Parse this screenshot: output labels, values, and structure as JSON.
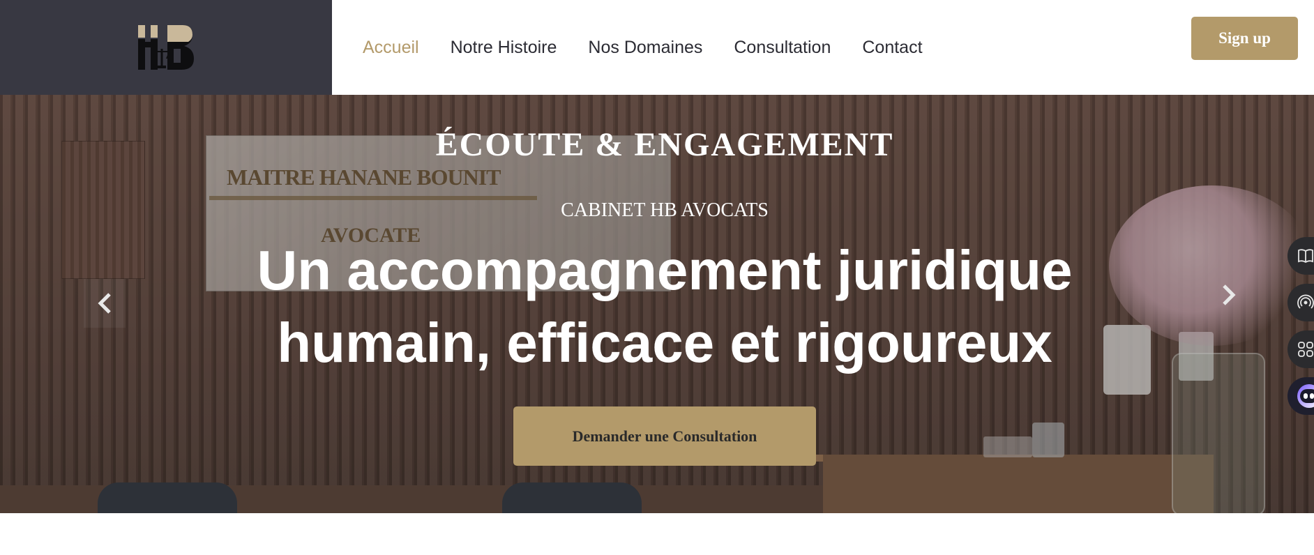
{
  "header": {
    "nav": [
      {
        "label": "Accueil",
        "active": true
      },
      {
        "label": "Notre Histoire",
        "active": false
      },
      {
        "label": "Nos Domaines",
        "active": false
      },
      {
        "label": "Consultation",
        "active": false
      },
      {
        "label": "Contact",
        "active": false
      }
    ],
    "signup_label": "Sign up"
  },
  "hero": {
    "eyebrow": "ÉCOUTE & ENGAGEMENT",
    "subtitle": "CABINET HB AVOCATS",
    "headline_line1": "Un accompagnement juridique",
    "headline_line2": "humain, efficace et rigoureux",
    "cta_label": "Demander une Consultation",
    "plaque_line1": "MAITRE HANANE BOUNIT",
    "plaque_line2": "AVOCATE"
  },
  "side_tools": [
    {
      "icon": "book-icon"
    },
    {
      "icon": "broadcast-icon"
    },
    {
      "icon": "apps-icon"
    },
    {
      "icon": "ai-assistant-icon"
    }
  ],
  "colors": {
    "accent": "#b39a6a",
    "logo_bg": "#383842",
    "nav_text": "#2b2b33"
  }
}
